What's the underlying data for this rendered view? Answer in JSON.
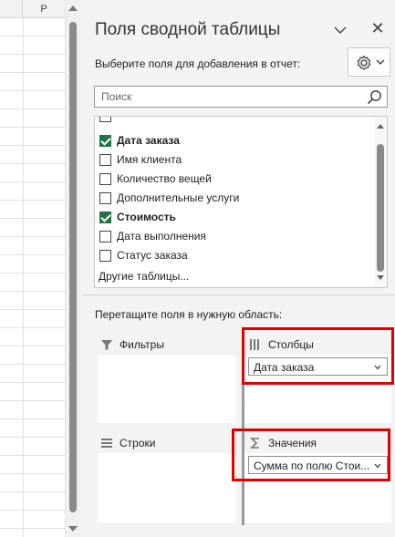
{
  "sheet": {
    "column_label": "P"
  },
  "pane": {
    "title": "Поля сводной таблицы",
    "subtitle": "Выберите поля для добавления в отчет:",
    "close_glyph": "✕",
    "search": {
      "placeholder": "Поиск"
    },
    "fields": [
      {
        "label": "Дата заказа",
        "checked": true
      },
      {
        "label": "Имя клиента",
        "checked": false
      },
      {
        "label": "Количество вещей",
        "checked": false
      },
      {
        "label": "Дополнительные услуги",
        "checked": false
      },
      {
        "label": "Стоимость",
        "checked": true
      },
      {
        "label": "Дата выполнения",
        "checked": false
      },
      {
        "label": "Статус заказа",
        "checked": false
      }
    ],
    "other_tables": "Другие таблицы...",
    "drag_hint": "Перетащите поля в нужную область:",
    "areas": {
      "filters": {
        "label": "Фильтры"
      },
      "columns": {
        "label": "Столбцы",
        "item": "Дата заказа"
      },
      "rows": {
        "label": "Строки"
      },
      "values": {
        "label": "Значения",
        "item": "Сумма по полю Стои..."
      }
    }
  },
  "colors": {
    "accent": "#217346",
    "highlight": "#e00000"
  }
}
